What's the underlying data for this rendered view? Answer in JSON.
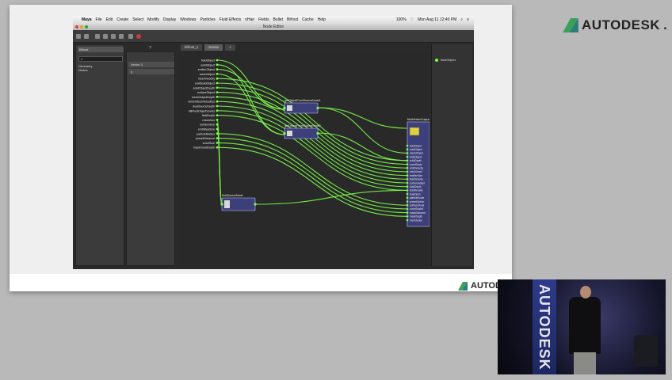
{
  "brand": {
    "name": "AUTODESK",
    "suffix": "."
  },
  "menubar": {
    "app": "Maya",
    "items": [
      "File",
      "Edit",
      "Create",
      "Select",
      "Modify",
      "Display",
      "Windows",
      "Particles",
      "Fluid Effects",
      "nHair",
      "Fields",
      "Bullet",
      "Bifrost",
      "Cache",
      "Help"
    ],
    "status": [
      "100%",
      "Mon Aug 11  12:40 PM"
    ]
  },
  "window": {
    "title": "Node Editor"
  },
  "tabs": [
    "bifrost_1",
    "Scene",
    "+"
  ],
  "left_panel": {
    "dropdown": "Bifrost",
    "search": "",
    "list": [
      "Geometry",
      "Nodes"
    ]
  },
  "mid_panel": {
    "header": "?",
    "rows": [
      "Vector 3",
      "y"
    ]
  },
  "graph": {
    "input_ports": [
      "fluidObject",
      "solidObject",
      "emitterObject",
      "meshObject",
      "meshVelocity",
      "emitSolidObject",
      "solidObjectDepth",
      "surfaceObject",
      "meshOutputDepth",
      "vertexMeshVelocities",
      "dualSourceDepth",
      "killFluidObjectVoxels",
      "fluidDepth",
      "resolution",
      "surfaceSize",
      "emitStepSize",
      "particleRadius",
      "presetDistance",
      "voxelSize",
      "maskVoxelDepth"
    ],
    "nodes": [
      {
        "label": "getObjectFromSourceNode1"
      },
      {
        "label": "getObjectFromSourceNode2"
      },
      {
        "label": "fluidSourceNode"
      },
      {
        "label": "fieldVertexOutput"
      }
    ],
    "sink_ports": [
      "fluidObject",
      "solidObject",
      "meshObject",
      "emitObject",
      "solidDepth",
      "voxelScale",
      "emitVelocity",
      "meshVoxel",
      "emitterSize",
      "fluidVelocity",
      "surfaceAdapt",
      "dualDepth",
      "fluidDensity",
      "dualOpen",
      "particleScale",
      "presetOption",
      "surfaceVoxel",
      "voxelScaleX",
      "maskDistance",
      "maskDepth",
      "meshScale"
    ],
    "output_label": "fluidObject"
  },
  "colors": {
    "wire": "#7cff4a",
    "node": "#3d3f7a",
    "graph_bg": "#292929"
  }
}
